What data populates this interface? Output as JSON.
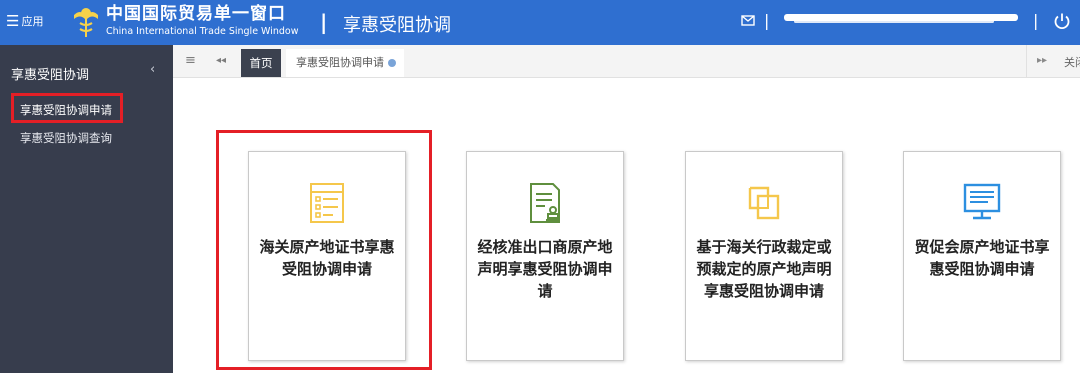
{
  "header": {
    "menu_label": "应用",
    "brand_cn": "中国国际贸易单一窗口",
    "brand_en": "China International Trade Single Window",
    "divider": "|",
    "page_title": "享惠受阻协调",
    "separator": "|"
  },
  "sidebar": {
    "title": "享惠受阻协调",
    "collapse": "‹",
    "items": [
      {
        "label": "享惠受阻协调申请"
      },
      {
        "label": "享惠受阻协调查询"
      }
    ]
  },
  "tabs": {
    "menu": "≡",
    "back": "◂◂",
    "home": "首页",
    "current": "享惠受阻协调申请",
    "forward": "▸▸",
    "close_label": "关闭"
  },
  "cards": [
    {
      "label": "海关原产地证书享惠受阻协调申请",
      "icon": "certificate-list-icon",
      "color": "#f5c74b"
    },
    {
      "label": "经核准出口商原产地声明享惠受阻协调申请",
      "icon": "document-stamp-icon",
      "color": "#5f8f3e"
    },
    {
      "label": "基于海关行政裁定或预裁定的原产地声明享惠受阻协调申请",
      "icon": "copy-documents-icon",
      "color": "#f5c74b"
    },
    {
      "label": "贸促会原产地证书享惠受阻协调申请",
      "icon": "monitor-icon",
      "color": "#2c8fe0"
    }
  ],
  "colors": {
    "topbar": "#2f6fd0",
    "sidebar": "#373d4d",
    "highlight": "#e41f26"
  }
}
